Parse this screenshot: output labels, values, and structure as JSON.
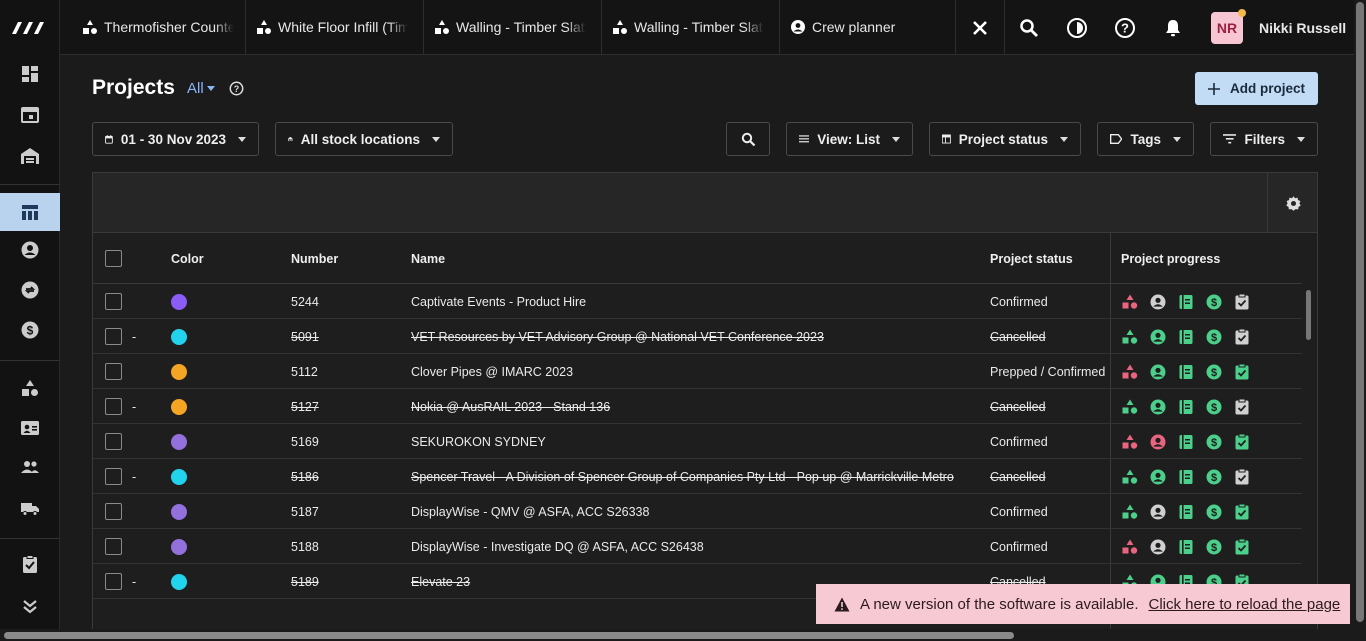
{
  "topbar": {
    "tabs": [
      {
        "label": "Thermofisher Counter",
        "icon": "cube-stack-icon"
      },
      {
        "label": "White Floor Infill (Timb",
        "icon": "cube-stack-icon"
      },
      {
        "label": "Walling - Timber Slatte",
        "icon": "cube-stack-icon"
      },
      {
        "label": "Walling - Timber Slatte",
        "icon": "cube-stack-icon"
      },
      {
        "label": "Crew planner",
        "icon": "user-circle-icon"
      }
    ],
    "user": {
      "initials": "NR",
      "name": "Nikki Russell"
    }
  },
  "header": {
    "title": "Projects",
    "scope": "All",
    "add_button": "Add project"
  },
  "controls": {
    "date_range": "01 - 30 Nov 2023",
    "location": "All stock locations",
    "view": "View: List",
    "status": "Project status",
    "tags": "Tags",
    "filters": "Filters"
  },
  "table": {
    "columns": {
      "color": "Color",
      "number": "Number",
      "name": "Name",
      "status": "Project status",
      "progress": "Project progress"
    },
    "rows": [
      {
        "dash": "",
        "color": "#8b5cf6",
        "number": "5244",
        "name": "Captivate Events - Product Hire",
        "status": "Confirmed",
        "cancelled": false,
        "progress": [
          "pink",
          "grey",
          "green",
          "green",
          "grey"
        ]
      },
      {
        "dash": "-",
        "color": "#22d3ee",
        "number": "5091",
        "name": "VET Resources by VET Advisory Group @ National VET Conference 2023",
        "status": "Cancelled",
        "cancelled": true,
        "progress": [
          "green",
          "green",
          "green",
          "green",
          "grey"
        ]
      },
      {
        "dash": "",
        "color": "#f5a524",
        "number": "5112",
        "name": "Clover Pipes @ IMARC 2023",
        "status": "Prepped / Confirmed",
        "cancelled": false,
        "progress": [
          "pink",
          "green",
          "green",
          "green",
          "green"
        ]
      },
      {
        "dash": "-",
        "color": "#f5a524",
        "number": "5127",
        "name": "Nokia @ AusRAIL 2023 - Stand 136",
        "status": "Cancelled",
        "cancelled": true,
        "progress": [
          "green",
          "green",
          "green",
          "green",
          "grey"
        ]
      },
      {
        "dash": "",
        "color": "#9370db",
        "number": "5169",
        "name": "SEKUROKON SYDNEY",
        "status": "Confirmed",
        "cancelled": false,
        "progress": [
          "pink",
          "pink",
          "green",
          "green",
          "green"
        ]
      },
      {
        "dash": "-",
        "color": "#22d3ee",
        "number": "5186",
        "name": "Spencer Travel - A Division of Spencer Group of Companies Pty Ltd - Pop up @ Marrickville Metro",
        "status": "Cancelled",
        "cancelled": true,
        "progress": [
          "green",
          "green",
          "green",
          "green",
          "grey"
        ]
      },
      {
        "dash": "",
        "color": "#9370db",
        "number": "5187",
        "name": "DisplayWise - QMV @ ASFA, ACC S26338",
        "status": "Confirmed",
        "cancelled": false,
        "progress": [
          "green",
          "grey",
          "green",
          "green",
          "green"
        ]
      },
      {
        "dash": "",
        "color": "#9370db",
        "number": "5188",
        "name": "DisplayWise - Investigate DQ @ ASFA, ACC S26438",
        "status": "Confirmed",
        "cancelled": false,
        "progress": [
          "pink",
          "grey",
          "green",
          "green",
          "green"
        ]
      },
      {
        "dash": "-",
        "color": "#22d3ee",
        "number": "5189",
        "name": "Elevate 23",
        "status": "Cancelled",
        "cancelled": true,
        "progress": [
          "green",
          "green",
          "green",
          "green",
          "green"
        ]
      }
    ]
  },
  "toast": {
    "message": "A new version of the software is available.",
    "link": "Click here to reload the page"
  },
  "colors": {
    "pink": "#e9657f",
    "green": "#4ccf8a",
    "grey": "#d0d0d0",
    "accent": "#c3dcf5"
  }
}
